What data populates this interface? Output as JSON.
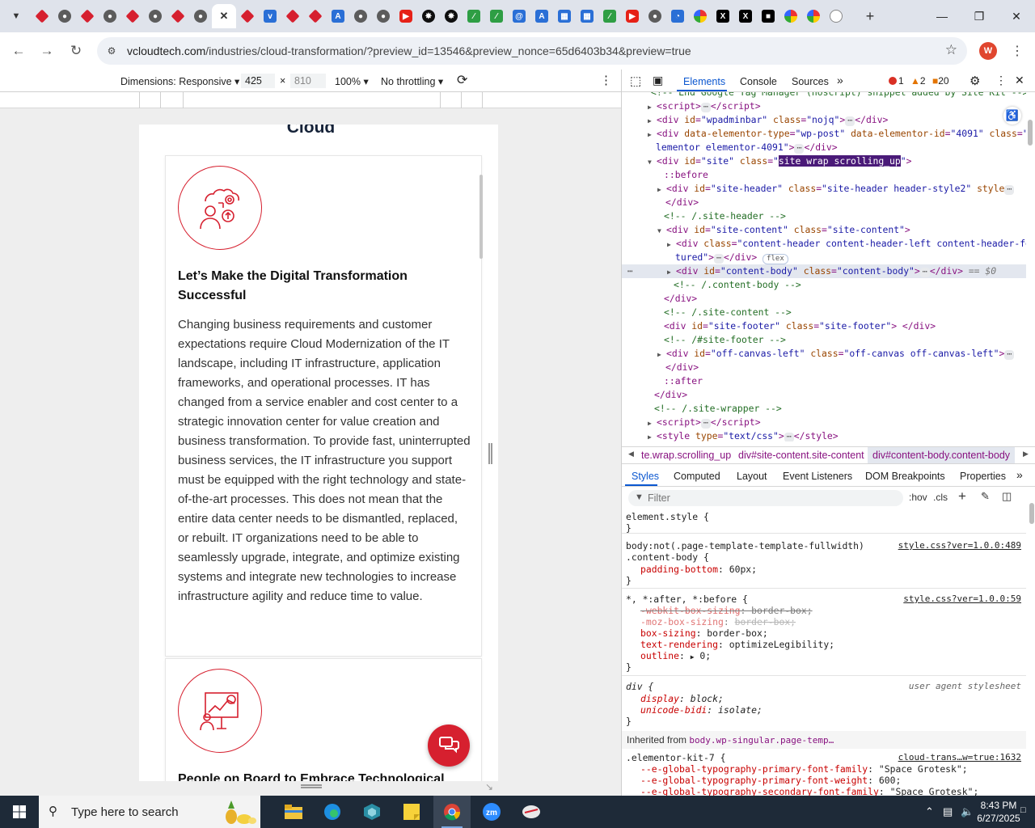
{
  "browser": {
    "tabs": [
      {
        "icon": "red-diamond-icon",
        "active": false
      },
      {
        "icon": "globe-icon",
        "active": false
      },
      {
        "icon": "red-diamond-icon",
        "active": false
      },
      {
        "icon": "globe-icon",
        "active": false
      },
      {
        "icon": "red-diamond-icon",
        "active": false
      },
      {
        "icon": "globe-icon",
        "active": false
      },
      {
        "icon": "red-diamond-icon",
        "active": false
      },
      {
        "icon": "globe-icon",
        "active": false
      },
      {
        "icon": "close-icon",
        "active": true
      },
      {
        "icon": "red-diamond-icon",
        "active": false
      },
      {
        "icon": "blue-v-icon",
        "active": false
      },
      {
        "icon": "red-diamond-icon",
        "active": false
      },
      {
        "icon": "red-diamond-icon",
        "active": false
      },
      {
        "icon": "translate-icon",
        "active": false
      },
      {
        "icon": "globe-icon",
        "active": false
      },
      {
        "icon": "globe-icon",
        "active": false
      },
      {
        "icon": "youtube-icon",
        "active": false
      },
      {
        "icon": "chatgpt-icon",
        "active": false
      },
      {
        "icon": "chatgpt-icon",
        "active": false
      },
      {
        "icon": "green-leaf-icon",
        "active": false
      },
      {
        "icon": "green-leaf-icon",
        "active": false
      },
      {
        "icon": "blue-swirl-icon",
        "active": false
      },
      {
        "icon": "translate-icon",
        "active": false
      },
      {
        "icon": "blue-grid-icon",
        "active": false
      },
      {
        "icon": "blue-grid-icon",
        "active": false
      },
      {
        "icon": "green-leaf-icon",
        "active": false
      },
      {
        "icon": "youtube-icon",
        "active": false
      },
      {
        "icon": "lock-icon",
        "active": false
      },
      {
        "icon": "gauge-icon",
        "active": false
      },
      {
        "icon": "color-circle-icon",
        "active": false
      },
      {
        "icon": "x-icon",
        "active": false
      },
      {
        "icon": "x-icon",
        "active": false
      },
      {
        "icon": "dark-square-icon",
        "active": false
      },
      {
        "icon": "color-circle-icon",
        "active": false
      },
      {
        "icon": "color-circle-icon",
        "active": false
      },
      {
        "icon": "red-slash-icon",
        "active": false
      }
    ],
    "new_tab": "+",
    "url_host": "vcloudtech.com",
    "url_rest": "/industries/cloud-transformation/?preview_id=13546&preview_nonce=65d6403b34&preview=true",
    "avatar_letter": "W"
  },
  "device_toolbar": {
    "dimensions_label": "Dimensions: Responsive",
    "width": "425",
    "times": "×",
    "height": "810",
    "zoom": "100%",
    "throttling": "No throttling"
  },
  "page": {
    "title": "Cloud",
    "card1": {
      "heading": "Let’s Make the Digital Transformation Successful",
      "body": "Changing business requirements and customer expectations require Cloud Modernization of the IT landscape, including IT infrastructure, application frameworks, and operational processes. IT has changed from a service enabler and cost center to a strategic innovation center for value creation and business transformation. To provide fast, uninterrupted business services, the IT infrastructure you support must be equipped with the right technology and state-of-the-art processes. This does not mean that the entire data center needs to be dismantled, replaced, or rebuilt. IT organizations need to be able to seamlessly upgrade, integrate, and optimize existing systems and integrate new technologies to increase infrastructure agility and reduce time to value."
    },
    "card2": {
      "heading": "People on Board to Embrace Technological"
    },
    "accent": "#d6202f"
  },
  "devtools": {
    "tabs": [
      "Elements",
      "Console",
      "Sources"
    ],
    "errors": "1",
    "warnings": "2",
    "issues": "20",
    "breadcrumbs": [
      "te.wrap.scrolling_up",
      "div#site-content.site-content",
      "div#content-body.content-body"
    ],
    "style_tabs": [
      "Styles",
      "Computed",
      "Layout",
      "Event Listeners",
      "DOM Breakpoints",
      "Properties"
    ],
    "filter_placeholder": "Filter",
    "hov": ":hov",
    "cls": ".cls",
    "styles": {
      "element_style": "element.style {",
      "close": "}",
      "rule1_sel1": "body:not(.page-template-template-fullwidth)",
      "rule1_sel2": ".content-body {",
      "rule1_src": "style.css?ver=1.0.0:489",
      "rule1_prop": "padding-bottom",
      "rule1_val": "60px;",
      "rule2_sel": "*, *:after, *:before {",
      "rule2_src": "style.css?ver=1.0.0:59",
      "rule2_p1": "-webkit-box-sizing",
      "rule2_v1": "border-box;",
      "rule2_p2": "-moz-box-sizing",
      "rule2_v2": "border-box;",
      "rule2_p3": "box-sizing",
      "rule2_v3": "border-box;",
      "rule2_p4": "text-rendering",
      "rule2_v4": "optimizeLegibility;",
      "rule2_p5": "outline",
      "rule2_v5": "0;",
      "rule3_sel": "div {",
      "rule3_src": "user agent stylesheet",
      "rule3_p1": "display",
      "rule3_v1": "block;",
      "rule3_p2": "unicode-bidi",
      "rule3_v2": "isolate;",
      "inherited_label": "Inherited from",
      "inherited_link": "body.wp-singular.page-temp…",
      "rule4_sel": ".elementor-kit-7 {",
      "rule4_src": "cloud-trans…w=true:1632",
      "rule4_p1": "--e-global-typography-primary-font-family",
      "rule4_v1": "\"Space Grotesk\";",
      "rule4_p2": "--e-global-typography-primary-font-weight",
      "rule4_v2": "600;",
      "rule4_p3": "--e-global-typography-secondary-font-family",
      "rule4_v3": "\"Space Grotesk\";"
    }
  },
  "taskbar": {
    "search_placeholder": "Type here to search",
    "time": "8:43 PM",
    "date": "6/27/2025"
  }
}
